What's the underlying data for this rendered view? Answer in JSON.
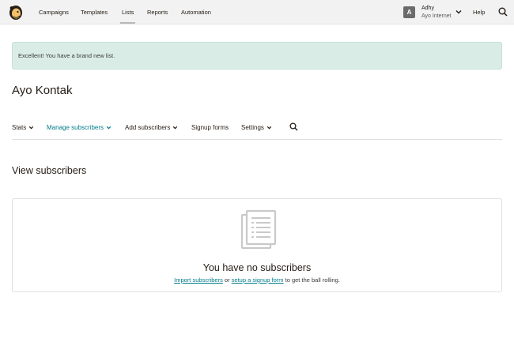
{
  "topnav": {
    "items": [
      {
        "label": "Campaigns"
      },
      {
        "label": "Templates"
      },
      {
        "label": "Lists"
      },
      {
        "label": "Reports"
      },
      {
        "label": "Automation"
      }
    ],
    "active": "Lists",
    "user": {
      "initial": "A",
      "name": "Adhy",
      "org": "Ayo Internet"
    },
    "help_label": "Help",
    "icons": {
      "search": "search-icon",
      "user_menu": "chevron-down-icon",
      "logo": "mailchimp-logo"
    }
  },
  "alert": {
    "text": "Excellent! You have a brand new list."
  },
  "page": {
    "title": "Ayo Kontak"
  },
  "subnav": {
    "items": [
      {
        "label": "Stats",
        "dropdown": true
      },
      {
        "label": "Manage subscribers",
        "dropdown": true,
        "active": true
      },
      {
        "label": "Add subscribers",
        "dropdown": true
      },
      {
        "label": "Signup forms",
        "dropdown": false
      },
      {
        "label": "Settings",
        "dropdown": true
      }
    ],
    "search_icon": "search-icon"
  },
  "section": {
    "title": "View subscribers"
  },
  "empty_state": {
    "icon": "document-list-icon",
    "title": "You have no subscribers",
    "link_import": "Import subscribers",
    "text_or": " or ",
    "link_signup": "setup a signup form",
    "text_tail": " to get the ball rolling."
  },
  "colors": {
    "accent": "#007c89",
    "alert_bg": "#d9ede6",
    "topbar_bg": "#f2f2f2"
  }
}
